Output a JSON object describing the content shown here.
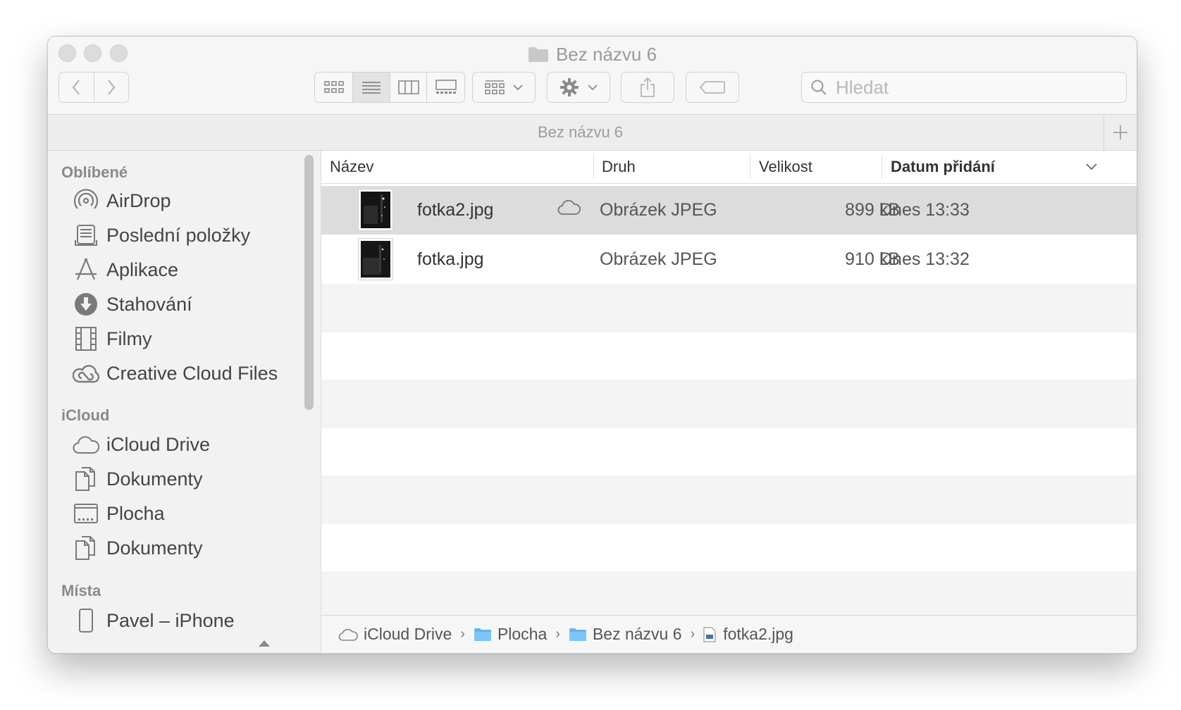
{
  "window": {
    "title": "Bez názvu 6",
    "title_icon": "folder-icon"
  },
  "toolbar": {
    "back_icon": "chevron-left-icon",
    "forward_icon": "chevron-right-icon",
    "view_modes": [
      "icons",
      "list",
      "columns",
      "gallery"
    ],
    "active_view": "list",
    "group_icon": "group-by-icon",
    "action_icon": "gear-icon",
    "share_icon": "share-icon",
    "tag_icon": "tag-icon",
    "search_placeholder": "Hledat"
  },
  "tabbar": {
    "label": "Bez názvu 6",
    "add_icon": "plus-icon"
  },
  "sidebar": {
    "sections": [
      {
        "title": "Oblíbené",
        "items": [
          {
            "label": "AirDrop",
            "icon": "airdrop-icon"
          },
          {
            "label": "Poslední položky",
            "icon": "recents-icon"
          },
          {
            "label": "Aplikace",
            "icon": "applications-icon"
          },
          {
            "label": "Stahování",
            "icon": "downloads-icon"
          },
          {
            "label": "Filmy",
            "icon": "movies-icon"
          },
          {
            "label": "Creative Cloud Files",
            "icon": "creative-cloud-icon"
          }
        ]
      },
      {
        "title": "iCloud",
        "items": [
          {
            "label": "iCloud Drive",
            "icon": "cloud-icon"
          },
          {
            "label": "Dokumenty",
            "icon": "documents-icon"
          },
          {
            "label": "Plocha",
            "icon": "desktop-icon"
          },
          {
            "label": "Dokumenty",
            "icon": "documents-icon"
          }
        ]
      },
      {
        "title": "Místa",
        "items": [
          {
            "label": "Pavel – iPhone",
            "icon": "iphone-icon",
            "eject_icon": "eject-icon"
          }
        ]
      }
    ]
  },
  "columns": {
    "name": "Název",
    "kind": "Druh",
    "size": "Velikost",
    "date": "Datum přidání",
    "sort_icon": "chevron-down-icon"
  },
  "files": [
    {
      "name": "fotka2.jpg",
      "kind": "Obrázek JPEG",
      "size": "899 kB",
      "date": "Dnes 13:33",
      "selected": true,
      "cloud_icon": "cloud-icon"
    },
    {
      "name": "fotka.jpg",
      "kind": "Obrázek JPEG",
      "size": "910 kB",
      "date": "Dnes 13:32",
      "selected": false
    }
  ],
  "pathbar": {
    "segments": [
      {
        "label": "iCloud Drive",
        "icon": "cloud-icon"
      },
      {
        "label": "Plocha",
        "icon": "folder-icon"
      },
      {
        "label": "Bez názvu 6",
        "icon": "folder-icon"
      },
      {
        "label": "fotka2.jpg",
        "icon": "jpeg-file-icon"
      }
    ]
  },
  "colors": {
    "selection": "#dcdcdc",
    "stripe": "#f4f4f4",
    "folder_blue": "#5fb4f0"
  }
}
